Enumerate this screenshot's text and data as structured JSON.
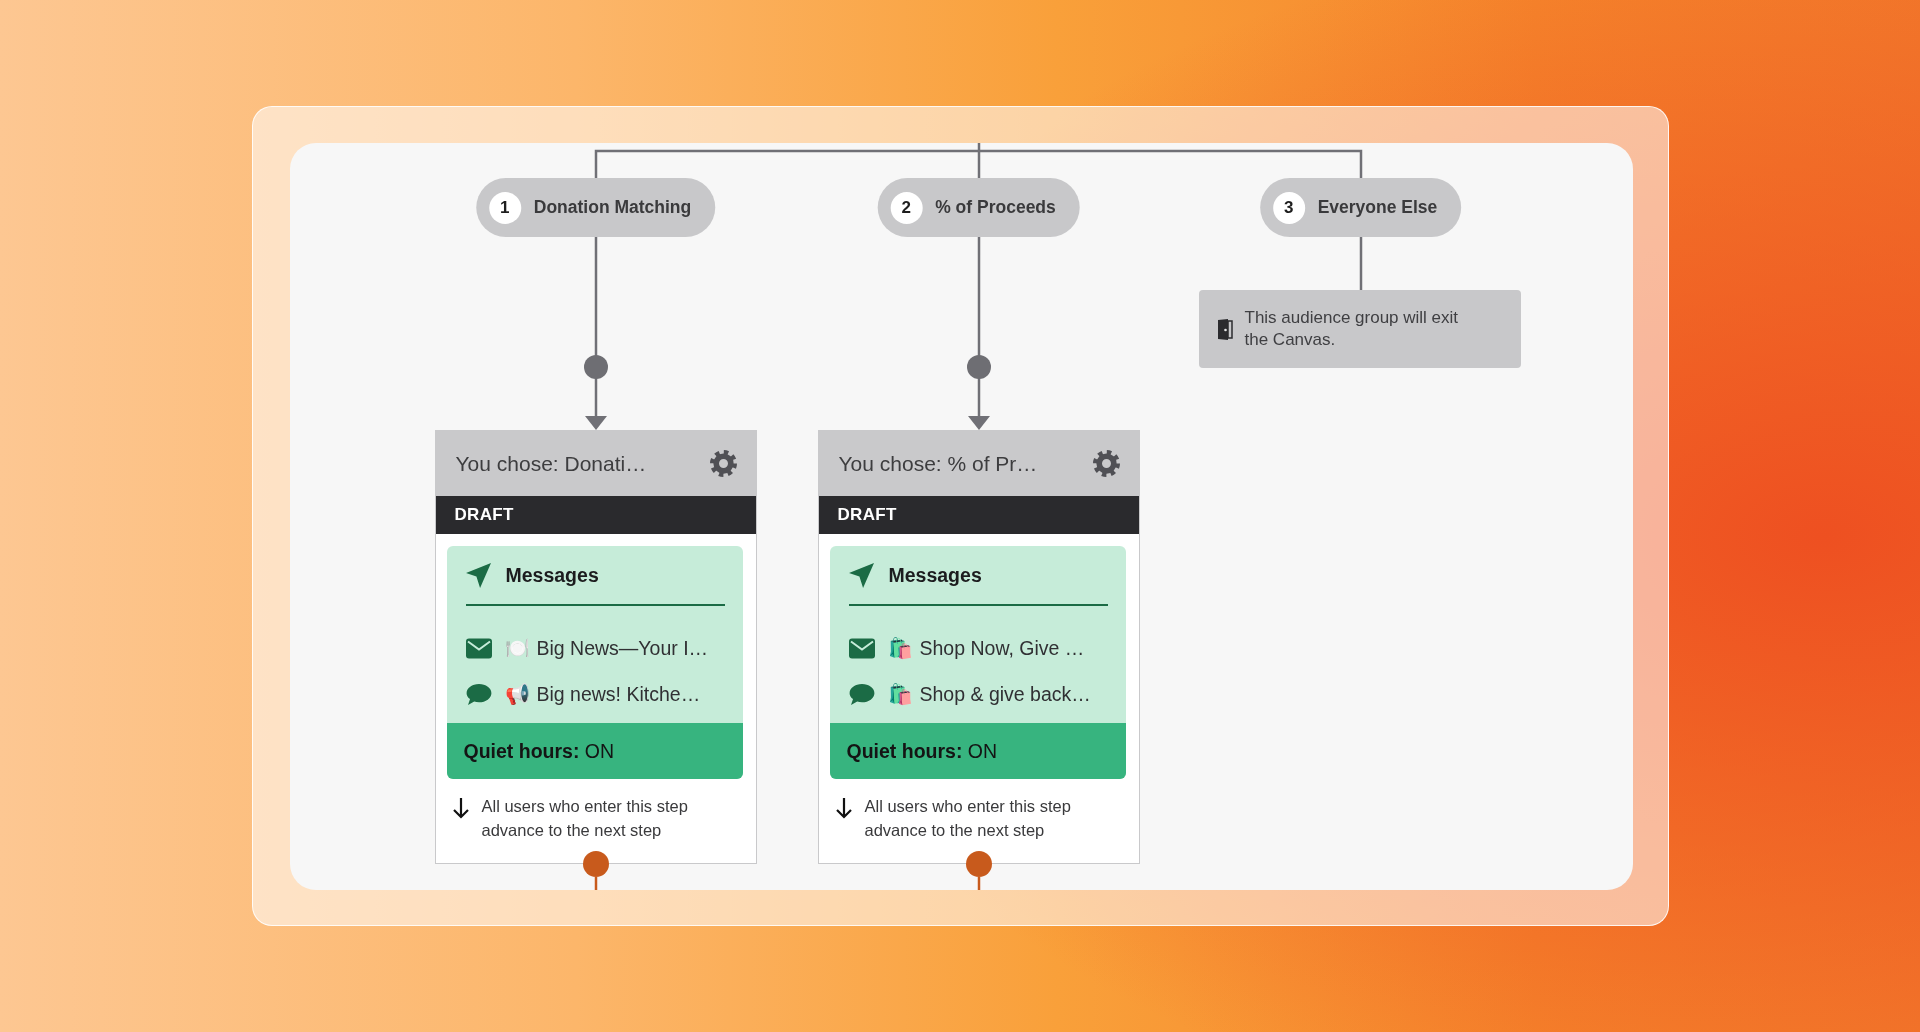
{
  "branches": [
    {
      "kind": "step",
      "number": "1",
      "label": "Donation Matching",
      "step": {
        "title": "You chose: Donati…",
        "status": "DRAFT",
        "messages_heading": "Messages",
        "messages": [
          {
            "kind": "email",
            "emoji": "🍽️",
            "text": "Big News—Your I…"
          },
          {
            "kind": "sms",
            "emoji": "📢",
            "text": "Big news! Kitche…"
          }
        ],
        "quiet_hours": "**Quiet hours:** ON",
        "advance_note": "All users who enter this step advance to the next step"
      }
    },
    {
      "kind": "step",
      "number": "2",
      "label": "% of Proceeds",
      "step": {
        "title": "You chose: % of Pr…",
        "status": "DRAFT",
        "messages_heading": "Messages",
        "messages": [
          {
            "kind": "email",
            "emoji": "🛍️",
            "text": "Shop Now, Give …"
          },
          {
            "kind": "sms",
            "emoji": "🛍️",
            "text": "Shop & give back…"
          }
        ],
        "quiet_hours": "**Quiet hours:** ON",
        "advance_note": "All users who enter this step advance to the next step"
      }
    },
    {
      "kind": "exit",
      "number": "3",
      "label": "Everyone Else",
      "exit_note": "This audience group will exit the Canvas."
    }
  ]
}
